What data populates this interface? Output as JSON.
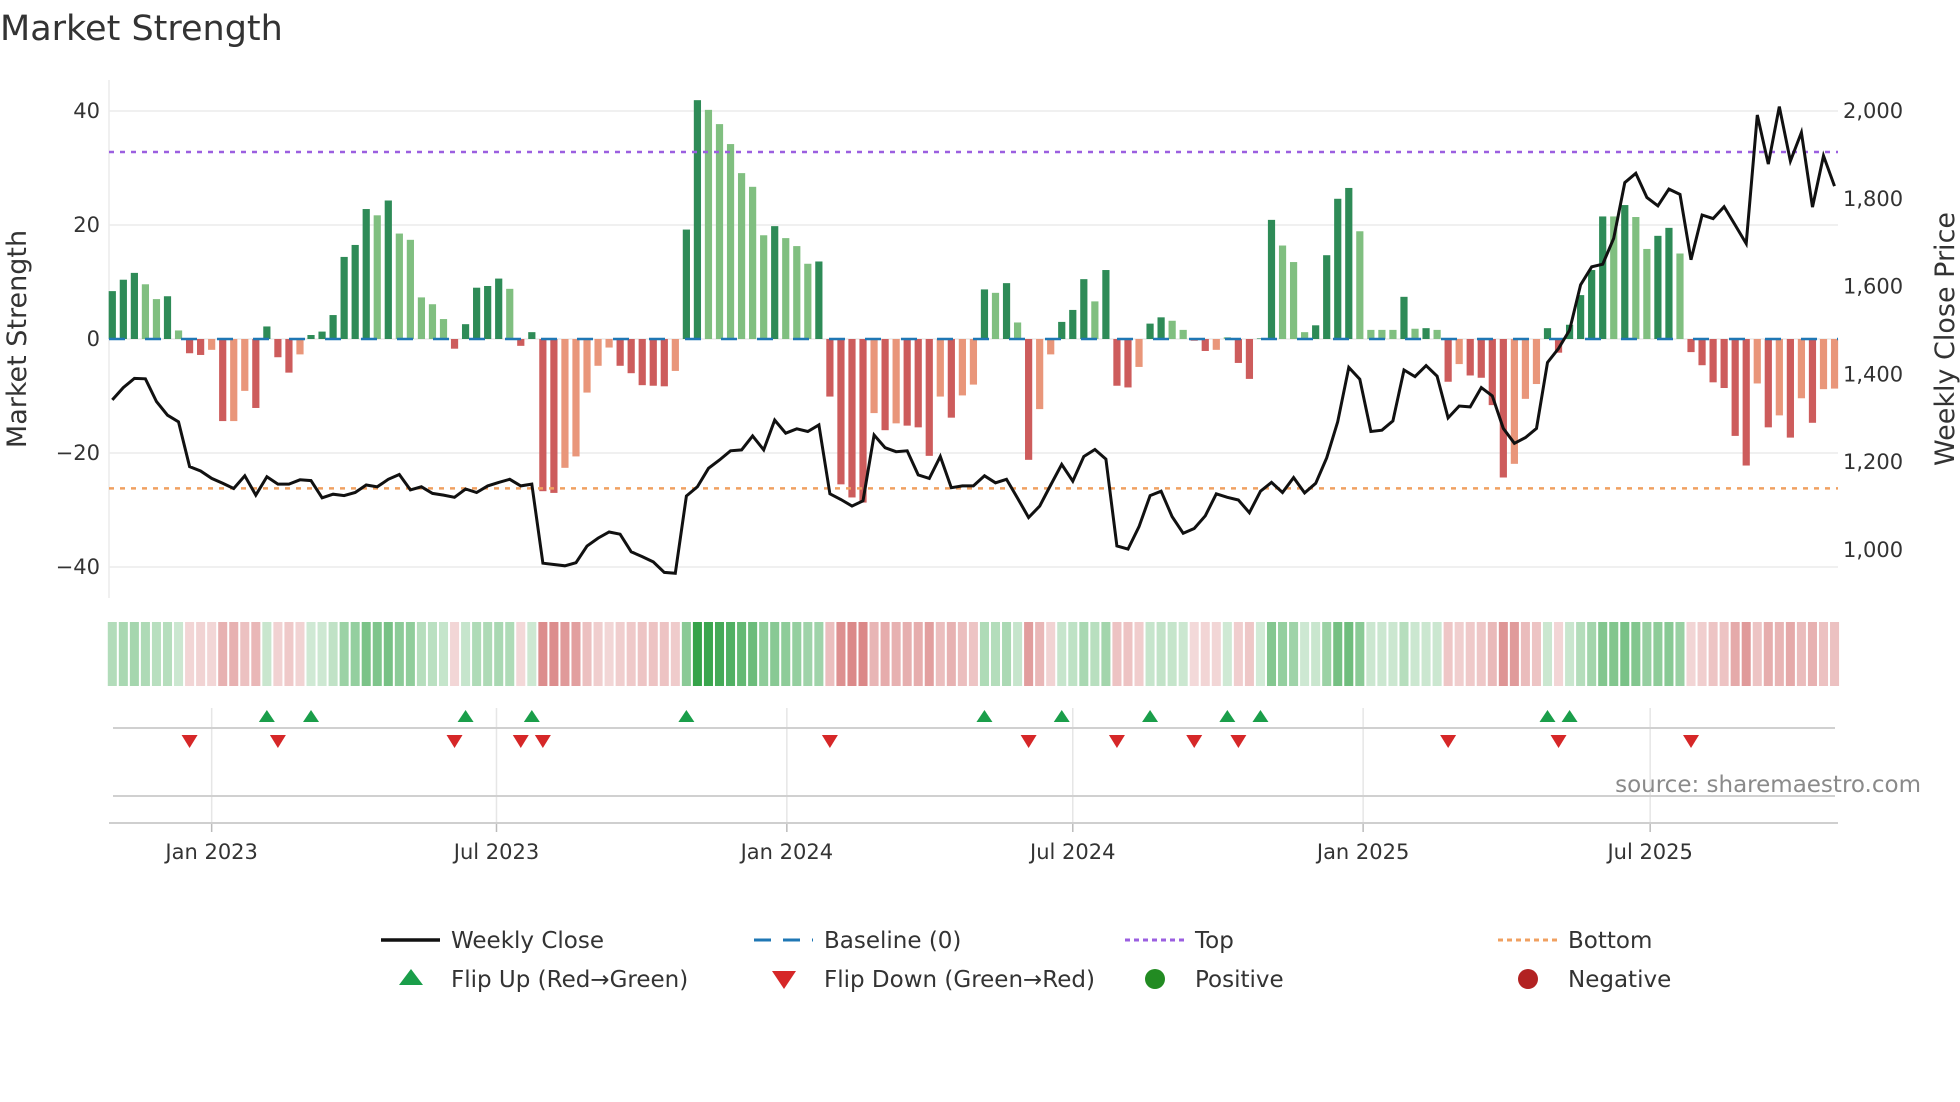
{
  "title": "Market Strength",
  "source": "source: sharemaestro.com",
  "chart_data": {
    "type": "bar",
    "title": "Market Strength",
    "ylabel": "Market Strength",
    "y2label": "Weekly Close Price",
    "ylim": [
      -45,
      45
    ],
    "y2lim": [
      915,
      2058
    ],
    "yticks": [
      {
        "v": 40,
        "label": "40"
      },
      {
        "v": 20,
        "label": "20"
      },
      {
        "v": 0,
        "label": "0"
      },
      {
        "v": -20,
        "label": "−20"
      },
      {
        "v": -40,
        "label": "−40"
      }
    ],
    "y2ticks": [
      {
        "v": 2000,
        "label": "2,000"
      },
      {
        "v": 1800,
        "label": "1,800"
      },
      {
        "v": 1600,
        "label": "1,600"
      },
      {
        "v": 1400,
        "label": "1,400"
      },
      {
        "v": 1200,
        "label": "1,200"
      },
      {
        "v": 1000,
        "label": "1,000"
      }
    ],
    "xticks": [
      {
        "week": 9,
        "label": "Jan 2023"
      },
      {
        "week": 34.8,
        "label": "Jul 2023"
      },
      {
        "week": 61.1,
        "label": "Jan 2024"
      },
      {
        "week": 87,
        "label": "Jul 2024"
      },
      {
        "week": 113.3,
        "label": "Jan 2025"
      },
      {
        "week": 139.3,
        "label": "Jul 2025"
      }
    ],
    "top_level": 32.8,
    "bottom_level": -26.2,
    "baseline": 0,
    "grid": true,
    "legend_position": "bottom",
    "colors": {
      "pos_dark": "#2e8b57",
      "pos_light": "#80bf80",
      "neg_dark": "#cd5c5c",
      "neg_light": "#e9967a",
      "close": "#111111",
      "baseline": "#1f77b4",
      "top": "#9b5fe0",
      "bottom": "#f0a060",
      "flip_up": "#1a9e4a",
      "flip_down": "#d62728",
      "positive": "#228b22",
      "negative": "#b22222",
      "heat_pos": "46,160,67",
      "heat_neg": "205,92,92"
    },
    "strength": [
      8.4,
      10.4,
      11.6,
      9.6,
      7.0,
      7.5,
      1.5,
      -2.5,
      -2.8,
      -1.9,
      -14.4,
      -14.4,
      -9.1,
      -12.1,
      2.2,
      -3.2,
      -5.9,
      -2.7,
      0.7,
      1.3,
      4.2,
      14.4,
      16.5,
      22.8,
      21.7,
      24.3,
      18.5,
      17.4,
      7.3,
      6.1,
      3.5,
      -1.7,
      2.6,
      9.0,
      9.3,
      10.6,
      8.8,
      -1.2,
      1.2,
      -26.7,
      -27.0,
      -22.6,
      -20.6,
      -9.4,
      -4.7,
      -1.5,
      -4.7,
      -6.0,
      -8.1,
      -8.2,
      -8.3,
      -5.6,
      19.2,
      41.9,
      40.2,
      37.7,
      34.2,
      29.1,
      26.7,
      18.2,
      19.8,
      17.7,
      16.3,
      13.2,
      13.6,
      -10.1,
      -25.5,
      -27.8,
      -28.7,
      -13.0,
      -16.0,
      -14.8,
      -15.2,
      -15.5,
      -20.5,
      -10.1,
      -13.8,
      -9.9,
      -8.0,
      8.7,
      8.1,
      9.8,
      2.9,
      -21.2,
      -12.3,
      -2.7,
      3.0,
      5.1,
      10.5,
      6.6,
      12.1,
      -8.2,
      -8.5,
      -4.9,
      2.7,
      3.8,
      3.2,
      1.6,
      -0.3,
      -2.1,
      -1.9,
      0.3,
      -4.2,
      -7.0,
      0.1,
      20.9,
      16.4,
      13.5,
      1.2,
      2.4,
      14.7,
      24.6,
      26.5,
      18.9,
      1.6,
      1.6,
      1.6,
      7.4,
      1.8,
      1.9,
      1.6,
      -7.5,
      -4.4,
      -6.4,
      -6.8,
      -11.6,
      -24.3,
      -21.9,
      -10.5,
      -7.9,
      1.9,
      -2.4,
      2.5,
      7.7,
      12.1,
      21.5,
      21.5,
      23.5,
      21.4,
      15.8,
      18.1,
      19.5,
      15.0,
      -2.3,
      -4.6,
      -7.6,
      -8.6,
      -17.0,
      -22.2,
      -7.8,
      -15.5,
      -13.4,
      -17.3,
      -10.4,
      -14.7,
      -8.8,
      -8.7
    ],
    "shade": "dddlldlddldlldddddlddddddldllllldddddldd",
    "shade_full": [
      "d",
      "d",
      "d",
      "l",
      "l",
      "d",
      "l",
      "d",
      "d",
      "l",
      "d",
      "l",
      "l",
      "d",
      "d",
      "d",
      "d",
      "l",
      "d",
      "d",
      "d",
      "d",
      "d",
      "d",
      "l",
      "d",
      "l",
      "l",
      "l",
      "l",
      "l",
      "d",
      "d",
      "d",
      "d",
      "d",
      "l",
      "d",
      "d",
      "d",
      "d",
      "l",
      "l",
      "l",
      "l",
      "l",
      "d",
      "d",
      "d",
      "d",
      "d",
      "l",
      "d",
      "d",
      "l",
      "l",
      "l",
      "l",
      "l",
      "l",
      "d",
      "l",
      "l",
      "l",
      "d",
      "d",
      "d",
      "d",
      "d",
      "l",
      "d",
      "l",
      "d",
      "d",
      "d",
      "l",
      "d",
      "l",
      "l",
      "d",
      "l",
      "d",
      "l",
      "d",
      "l",
      "l",
      "d",
      "d",
      "d",
      "l",
      "d",
      "d",
      "d",
      "l",
      "d",
      "d",
      "l",
      "l",
      "d",
      "d",
      "l",
      "l",
      "d",
      "d",
      "d",
      "d",
      "l",
      "l",
      "l",
      "d",
      "d",
      "d",
      "d",
      "l",
      "l",
      "l",
      "l",
      "d",
      "l",
      "d",
      "l",
      "d",
      "l",
      "d",
      "d",
      "d",
      "d",
      "l",
      "l",
      "l",
      "d",
      "d",
      "d",
      "d",
      "d",
      "d",
      "l",
      "d",
      "l",
      "l",
      "d",
      "d",
      "l",
      "d",
      "d",
      "d",
      "d",
      "d",
      "d",
      "l",
      "d",
      "l",
      "d",
      "l",
      "d",
      "l",
      "l"
    ],
    "close": [
      1342,
      1370,
      1391,
      1390,
      1338,
      1307,
      1292,
      1190,
      1180,
      1163,
      1152,
      1140,
      1169,
      1125,
      1167,
      1150,
      1150,
      1160,
      1158,
      1119,
      1127,
      1124,
      1131,
      1148,
      1144,
      1161,
      1172,
      1137,
      1144,
      1129,
      1125,
      1120,
      1139,
      1131,
      1146,
      1154,
      1161,
      1146,
      1150,
      970,
      967,
      964,
      971,
      1009,
      1027,
      1041,
      1036,
      996,
      985,
      973,
      949,
      947,
      1123,
      1144,
      1186,
      1205,
      1226,
      1228,
      1260,
      1228,
      1296,
      1266,
      1276,
      1270,
      1285,
      1128,
      1115,
      1100,
      1112,
      1262,
      1233,
      1224,
      1226,
      1171,
      1163,
      1213,
      1142,
      1146,
      1146,
      1169,
      1153,
      1161,
      1118,
      1074,
      1100,
      1148,
      1195,
      1157,
      1213,
      1229,
      1207,
      1009,
      1002,
      1053,
      1124,
      1134,
      1076,
      1038,
      1049,
      1078,
      1128,
      1120,
      1114,
      1085,
      1134,
      1154,
      1131,
      1165,
      1130,
      1152,
      1210,
      1292,
      1416,
      1389,
      1270,
      1273,
      1294,
      1410,
      1395,
      1420,
      1396,
      1301,
      1328,
      1326,
      1370,
      1351,
      1277,
      1243,
      1256,
      1277,
      1427,
      1459,
      1501,
      1604,
      1645,
      1651,
      1710,
      1837,
      1858,
      1803,
      1784,
      1822,
      1810,
      1661,
      1763,
      1755,
      1782,
      1740,
      1698,
      1991,
      1879,
      2010,
      1886,
      1951,
      1781,
      1898,
      1829
    ],
    "legend": [
      {
        "key": "close",
        "label": "Weekly Close"
      },
      {
        "key": "baseline",
        "label": "Baseline (0)"
      },
      {
        "key": "top",
        "label": "Top"
      },
      {
        "key": "bottom",
        "label": "Bottom"
      },
      {
        "key": "flip_up",
        "label": "Flip Up (Red→Green)"
      },
      {
        "key": "flip_down",
        "label": "Flip Down (Green→Red)"
      },
      {
        "key": "positive",
        "label": "Positive"
      },
      {
        "key": "negative",
        "label": "Negative"
      }
    ]
  }
}
